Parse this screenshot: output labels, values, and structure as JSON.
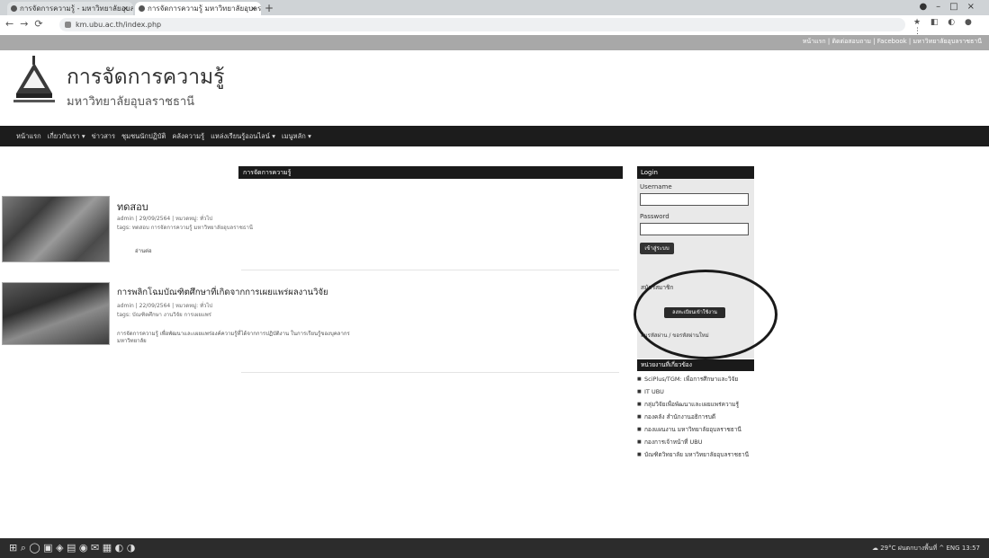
{
  "browser": {
    "tabs": [
      {
        "label": "การจัดการความรู้ - มหาวิทยาลัยอุบลราชธานี"
      },
      {
        "label": "การจัดการความรู้ มหาวิทยาลัยอุบลราชธานี"
      }
    ],
    "new_tab": "+",
    "window_controls": "●–□×",
    "nav_buttons": "←→⟳",
    "url": "km.ubu.ac.th/index.php",
    "extension_icons": "★ ◧ ◐ ● ⋮"
  },
  "top_strip": {
    "links": "หน้าแรก | ติดต่อสอบถาม | Facebook | มหาวิทยาลัยอุบลราชธานี"
  },
  "header": {
    "title": "การจัดการความรู้",
    "subtitle": "มหาวิทยาลัยอุบลราชธานี"
  },
  "nav": {
    "items": [
      "หน้าแรก",
      "เกี่ยวกับเรา ▾",
      "ข่าวสาร",
      "ชุมชนนักปฏิบัติ",
      "คลังความรู้",
      "แหล่งเรียนรู้ออนไลน์ ▾",
      "เมนูหลัก ▾"
    ]
  },
  "main": {
    "heading": "การจัดการความรู้",
    "articles": [
      {
        "title": "ทดสอบ",
        "meta": "admin | 29/09/2564 | หมวดหมู่: ทั่วไป",
        "tags": "tags: ทดสอบ การจัดการความรู้ มหาวิทยาลัยอุบลราชธานี",
        "button": "อ่านต่อ"
      },
      {
        "title": "การพลิกโฉมบัณฑิตศึกษาที่เกิดจากการเผยแพร่ผลงานวิจัย",
        "meta": "admin | 22/09/2564 | หมวดหมู่: ทั่วไป",
        "tags": "tags: บัณฑิตศึกษา งานวิจัย การเผยแพร่",
        "body": "การจัดการความรู้ เพื่อพัฒนาและเผยแพร่องค์ความรู้ที่ได้จากการปฏิบัติงาน ในการเรียนรู้ของบุคลากรมหาวิทยาลัย"
      }
    ]
  },
  "login": {
    "heading": "Login",
    "username_label": "Username",
    "password_label": "Password",
    "login_button": "เข้าสู่ระบบ",
    "register_text": "สมัครสมาชิก",
    "register_button": "ลงทะเบียนเข้าใช้งาน",
    "forgot_text": "ลืมรหัสผ่าน / ขอรหัสผ่านใหม่"
  },
  "related": {
    "heading": "หน่วยงานที่เกี่ยวข้อง",
    "items": [
      "SciPlus/TGM: เพื่อการศึกษาและวิจัย",
      "IT UBU",
      "กลุ่มวิจัยเพื่อพัฒนาและเผยแพร่ความรู้",
      "กองคลัง สำนักงานอธิการบดี",
      "กองแผนงาน มหาวิทยาลัยอุบลราชธานี",
      "กองการเจ้าหน้าที่ UBU",
      "บัณฑิตวิทยาลัย มหาวิทยาลัยอุบลราชธานี"
    ]
  },
  "taskbar": {
    "icons": "⊞ ⌕ ◯ ▣ ◈ ▤ ◉ ✉ ▦ ◐ ◑",
    "tray": "☁ 29°C ฝนตกบางพื้นที่ ^ ENG 13:57"
  }
}
